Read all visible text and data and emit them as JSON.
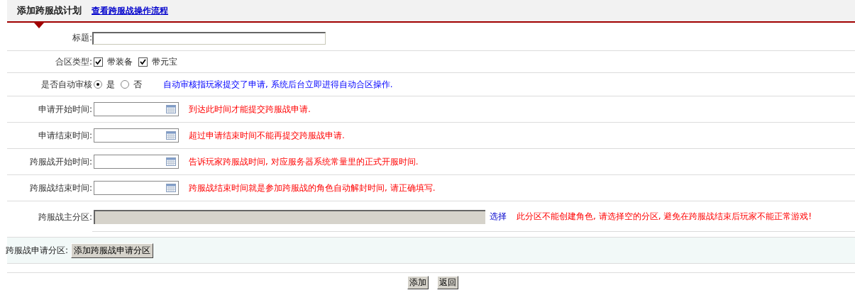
{
  "header": {
    "title": "添加跨服战计划",
    "link": "查看跨服战操作流程"
  },
  "fields": [
    {
      "kind": "text",
      "label": "标题:"
    },
    {
      "kind": "checkboxes",
      "label": "合区类型:",
      "options": [
        {
          "label": "带装备",
          "checked": true
        },
        {
          "label": "带元宝",
          "checked": true
        }
      ]
    },
    {
      "kind": "radios",
      "label": "是否自动审核",
      "options": [
        {
          "label": "是",
          "selected": true
        },
        {
          "label": "否",
          "selected": false
        }
      ],
      "note": {
        "kind": "info",
        "text": "自动审核指玩家提交了申请, 系统后台立即进得自动合区操作."
      }
    },
    {
      "kind": "date",
      "label": "申请开始时间:",
      "note": {
        "kind": "warning",
        "text": "到达此时间才能提交跨服战申请."
      }
    },
    {
      "kind": "date",
      "label": "申请结束时间:",
      "note": {
        "kind": "warning",
        "text": "超过申请结束时间不能再提交跨服战申请."
      }
    },
    {
      "kind": "date",
      "label": "跨服战开始时间:",
      "note": {
        "kind": "warning",
        "text": "告诉玩家跨服战时间, 对应服务器系统常量里的正式开服时间."
      }
    },
    {
      "kind": "date",
      "label": "跨服战结束时间:",
      "note": {
        "kind": "warning",
        "text": "跨服战结束时间就是参加跨服战的角色自动解封时间, 请正确填写."
      }
    },
    {
      "kind": "partition",
      "label": "跨服战主分区:",
      "link": "选择",
      "note": {
        "kind": "warning",
        "text": "此分区不能创建角色, 请选择空的分区, 避免在跨服战结束后玩家不能正常游戏!"
      }
    }
  ],
  "apply": {
    "label": "跨服战申请分区:",
    "button": "添加跨服战申请分区"
  },
  "buttons": [
    "添加",
    "返回"
  ]
}
